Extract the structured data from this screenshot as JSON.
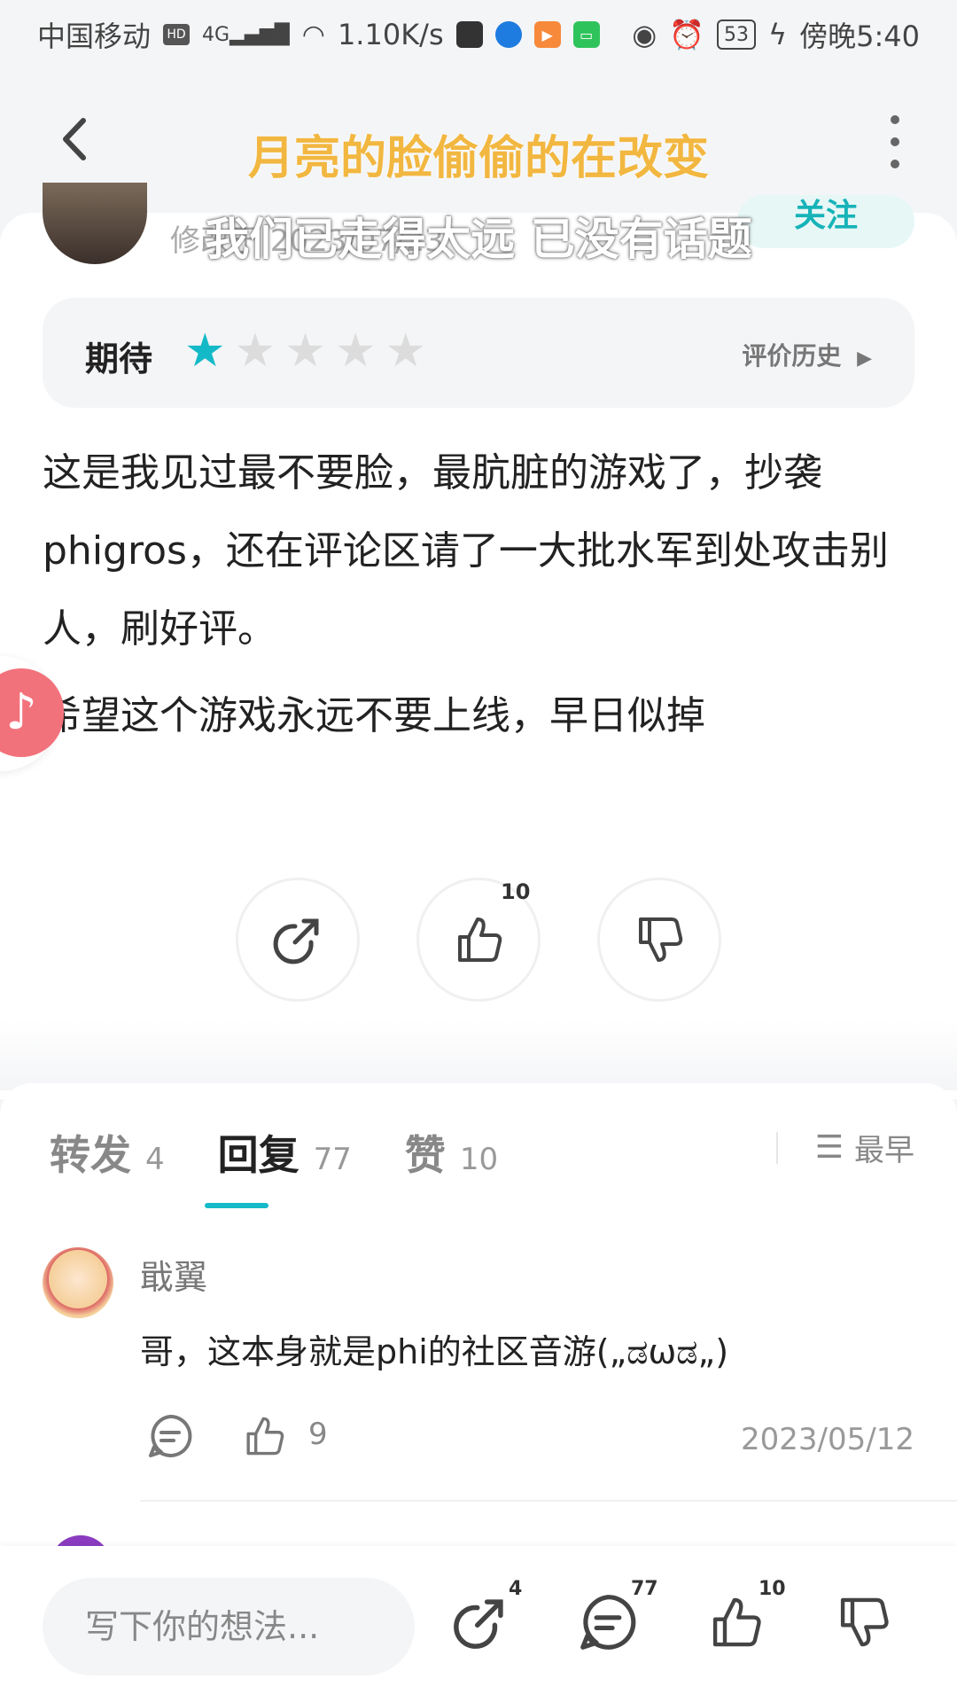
{
  "status_bar": {
    "carrier": "中国移动",
    "hd": "HD",
    "network": "4G",
    "speed": "1.10K/s",
    "battery": "53",
    "time": "傍晚5:40"
  },
  "header": {
    "lyric_line1": "月亮的脸偷偷的在改变",
    "lyric_line2": "我们已走得太远 已没有话题"
  },
  "author": {
    "modified_date": "修改于 2023/07/23",
    "follow_label": "关注"
  },
  "rating": {
    "label": "期待",
    "stars": 1,
    "max_stars": 5,
    "history_label": "评价历史",
    "accent_color": "#14b9c8"
  },
  "review": {
    "paragraph1": "这是我见过最不要脸，最肮脏的游戏了，抄袭phigros，还在评论区请了一大批水军到处攻击别人，刷好评。",
    "paragraph2": "希望这个游戏永远不要上线，早日似掉"
  },
  "actions": {
    "like_count": "10"
  },
  "tabs": [
    {
      "label": "转发",
      "count": "4"
    },
    {
      "label": "回复",
      "count": "77"
    },
    {
      "label": "赞",
      "count": "10"
    }
  ],
  "sort": {
    "label": "最早"
  },
  "reply": {
    "name": "戢翼",
    "text": "哥，这本身就是phi的社区音游(„ಡωಡ„)",
    "like_count": "9",
    "date": "2023/05/12"
  },
  "bottom_bar": {
    "placeholder": "写下你的想法...",
    "repost_count": "4",
    "comment_count": "77",
    "like_count": "10"
  }
}
